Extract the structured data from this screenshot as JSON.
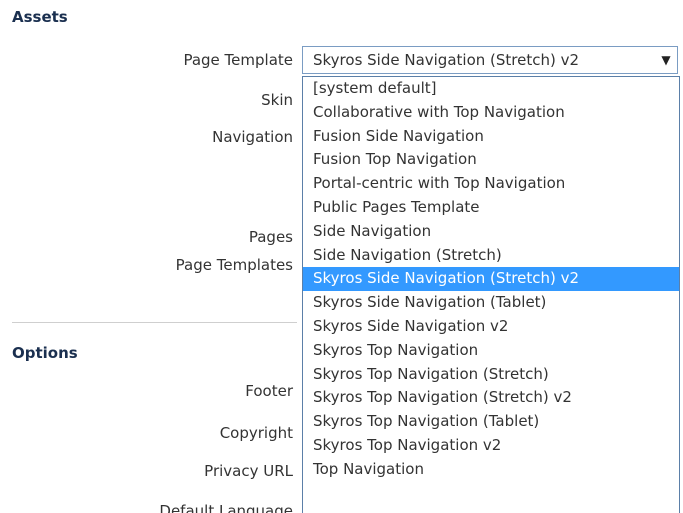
{
  "assets": {
    "title": "Assets",
    "labels": {
      "page_template": "Page Template",
      "skin": "Skin",
      "navigation": "Navigation",
      "pages": "Pages",
      "page_templates": "Page Templates"
    }
  },
  "options": {
    "title": "Options",
    "labels": {
      "footer": "Footer",
      "copyright": "Copyright",
      "privacy_url": "Privacy URL",
      "default_language": "Default Language"
    }
  },
  "page_template_select": {
    "value": "Skyros Side Navigation (Stretch) v2",
    "arrow_icon": "caret-down-icon",
    "selected_index": 8,
    "options": [
      "[system default]",
      "Collaborative with Top Navigation",
      "Fusion Side Navigation",
      "Fusion Top Navigation",
      "Portal-centric with Top Navigation",
      "Public Pages Template",
      "Side Navigation",
      "Side Navigation (Stretch)",
      "Skyros Side Navigation (Stretch) v2",
      "Skyros Side Navigation (Tablet)",
      "Skyros Side Navigation v2",
      "Skyros Top Navigation",
      "Skyros Top Navigation (Stretch)",
      "Skyros Top Navigation (Stretch) v2",
      "Skyros Top Navigation (Tablet)",
      "Skyros Top Navigation v2",
      "Top Navigation"
    ]
  },
  "colors": {
    "section_title": "#1a2f4f",
    "selection_bg": "#3399ff",
    "dropdown_border": "#5b7fa8"
  }
}
